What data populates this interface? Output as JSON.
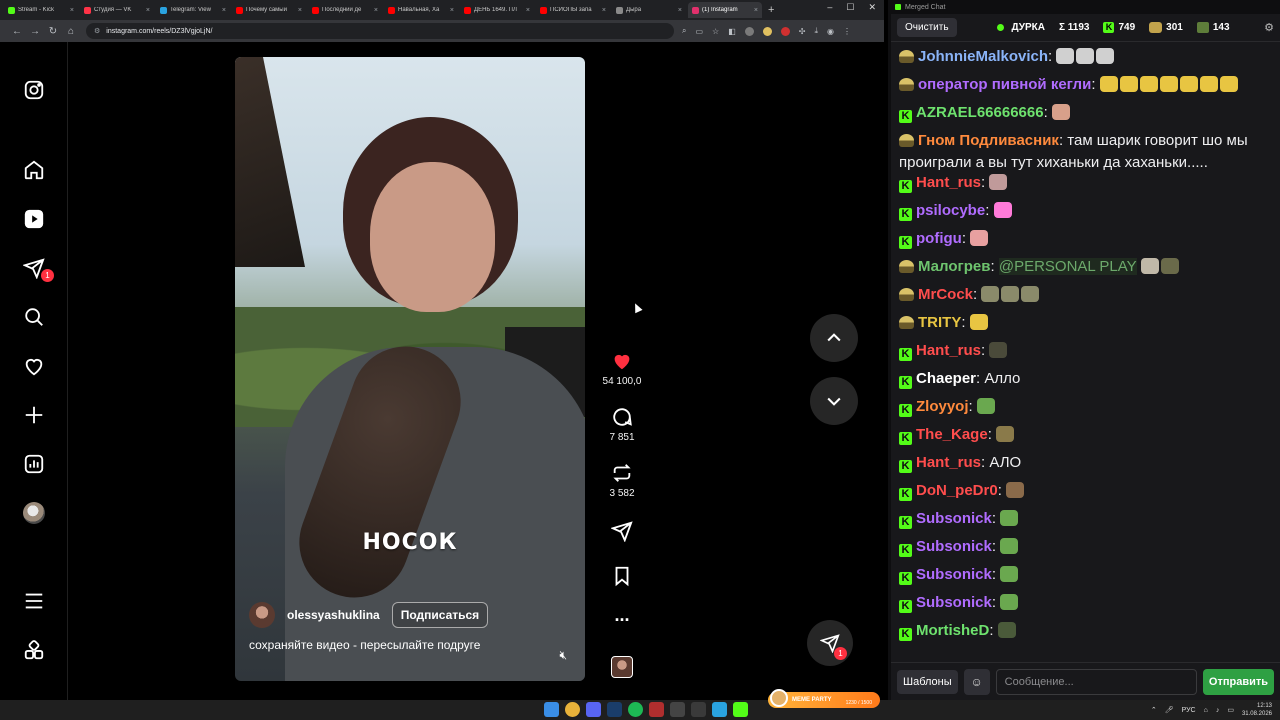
{
  "browser": {
    "tabs": [
      {
        "label": "Stream - Kick",
        "color": "#53fc18",
        "active": false
      },
      {
        "label": "Студия — VK",
        "color": "#ff3347",
        "active": false
      },
      {
        "label": "Telegram: View",
        "color": "#2aa3e0",
        "active": false
      },
      {
        "label": "Почему самый",
        "color": "#ff0000",
        "active": false
      },
      {
        "label": "Последний де",
        "color": "#ff0000",
        "active": false
      },
      {
        "label": "Навальная, Ха",
        "color": "#ff0000",
        "active": false
      },
      {
        "label": "ДЕНЬ 1649. ПЛ",
        "color": "#ff0000",
        "active": false
      },
      {
        "label": "ПСИОПЫ запа",
        "color": "#ff0000",
        "active": false
      },
      {
        "label": "Дыра",
        "color": "#8a8a8a",
        "active": false
      },
      {
        "label": "(1) Instagram",
        "color": "#e1306c",
        "active": true
      }
    ],
    "url": "instagram.com/reels/DZ3lVgjoLjN/"
  },
  "instagram": {
    "side_badge": "1",
    "reel_caption": "НОСОК",
    "author": "olessyashuklina",
    "follow_label": "Подписаться",
    "description": "сохраняйте видео - пересылайте подруге",
    "likes": "54 100,0",
    "comments": "7 851",
    "reposts": "3 582",
    "more": "...",
    "fab_badge": "1"
  },
  "chat": {
    "window_title": "Merged Chat",
    "clear_label": "Очистить",
    "channel": "ДУРКА",
    "total": "Σ 1193",
    "kick_count": "749",
    "yt_count": "301",
    "tw_count": "143",
    "templates_label": "Шаблоны",
    "input_placeholder": "Сообщение...",
    "send_label": "Отправить",
    "messages": [
      {
        "platform": "y",
        "user": "JohnnieMalkovich",
        "color": "#8ab4f8",
        "text": "",
        "emotes": [
          "#d0d0d0",
          "#d0d0d0",
          "#d0d0d0"
        ]
      },
      {
        "platform": "y",
        "user": "оператор пивной кегли",
        "color": "#b06cff",
        "text": "",
        "emotes": [
          "#e8c542",
          "#e8c542",
          "#e8c542",
          "#e8c542",
          "#e8c542",
          "#e8c542",
          "#e8c542"
        ]
      },
      {
        "platform": "k",
        "user": "AZRAEL66666666",
        "color": "#6ee26e",
        "text": "",
        "emotes": [
          "#d8a08a"
        ]
      },
      {
        "platform": "y",
        "user": "Гном Подливасник",
        "color": "#ff8a3d",
        "text": "там шарик говорит шо мы проиграли а вы тут хиханьки да хаханьки.....",
        "emotes": []
      },
      {
        "platform": "k",
        "user": "Hant_rus",
        "color": "#ff4d4d",
        "text": "",
        "emotes": [
          "#c09a9a"
        ]
      },
      {
        "platform": "k",
        "user": "psilocybe",
        "color": "#b06cff",
        "text": "",
        "emotes": [
          "#ff7ad9"
        ]
      },
      {
        "platform": "k",
        "user": "pofigu",
        "color": "#b06cff",
        "text": "",
        "emotes": [
          "#e8a0a0"
        ]
      },
      {
        "platform": "y",
        "user": "Малогрев",
        "color": "#6ec46e",
        "text": "",
        "mention": "@PERSONAL PLAY",
        "emotes": [
          "#c0b8a8",
          "#6a6a4a"
        ]
      },
      {
        "platform": "y",
        "user": "MrCock",
        "color": "#ff4d4d",
        "text": "",
        "emotes": [
          "#8a8a6a",
          "#8a8a6a",
          "#8a8a6a"
        ]
      },
      {
        "platform": "y",
        "user": "TRITY",
        "color": "#e8c542",
        "text": "",
        "emotes": [
          "#e8c542"
        ]
      },
      {
        "platform": "k",
        "user": "Hant_rus",
        "color": "#ff4d4d",
        "text": "",
        "emotes": [
          "#4a4a3a"
        ]
      },
      {
        "platform": "k",
        "user": "Chaeper",
        "color": "#ffffff",
        "text": "Алло",
        "emotes": []
      },
      {
        "platform": "k",
        "user": "Zloyyoj",
        "color": "#ff8a3d",
        "text": "",
        "emotes": [
          "#6aa84f"
        ]
      },
      {
        "platform": "k",
        "user": "The_Kage",
        "color": "#ff4d4d",
        "text": "",
        "emotes": [
          "#8a7a4a"
        ]
      },
      {
        "platform": "k",
        "user": "Hant_rus",
        "color": "#ff4d4d",
        "text": "АЛО",
        "emotes": []
      },
      {
        "platform": "k",
        "user": "DoN_peDr0",
        "color": "#ff4d4d",
        "text": "",
        "emotes": [
          "#8a6a4a"
        ]
      },
      {
        "platform": "k",
        "user": "Subsonick",
        "color": "#b06cff",
        "text": "",
        "emotes": [
          "#6aa84f"
        ]
      },
      {
        "platform": "k",
        "user": "Subsonick",
        "color": "#b06cff",
        "text": "",
        "emotes": [
          "#6aa84f"
        ]
      },
      {
        "platform": "k",
        "user": "Subsonick",
        "color": "#b06cff",
        "text": "",
        "emotes": [
          "#6aa84f"
        ]
      },
      {
        "platform": "k",
        "user": "Subsonick",
        "color": "#b06cff",
        "text": "",
        "emotes": [
          "#6aa84f"
        ]
      },
      {
        "platform": "k",
        "user": "MortisheD",
        "color": "#6ee26e",
        "text": "",
        "emotes": [
          "#4a5a3a"
        ]
      }
    ]
  },
  "taskbar": {
    "lang": "РУС",
    "time": "12:13",
    "date": "31.08.2026",
    "meme_label": "MEME PARTY",
    "meme_value": "1230 / 1500"
  }
}
